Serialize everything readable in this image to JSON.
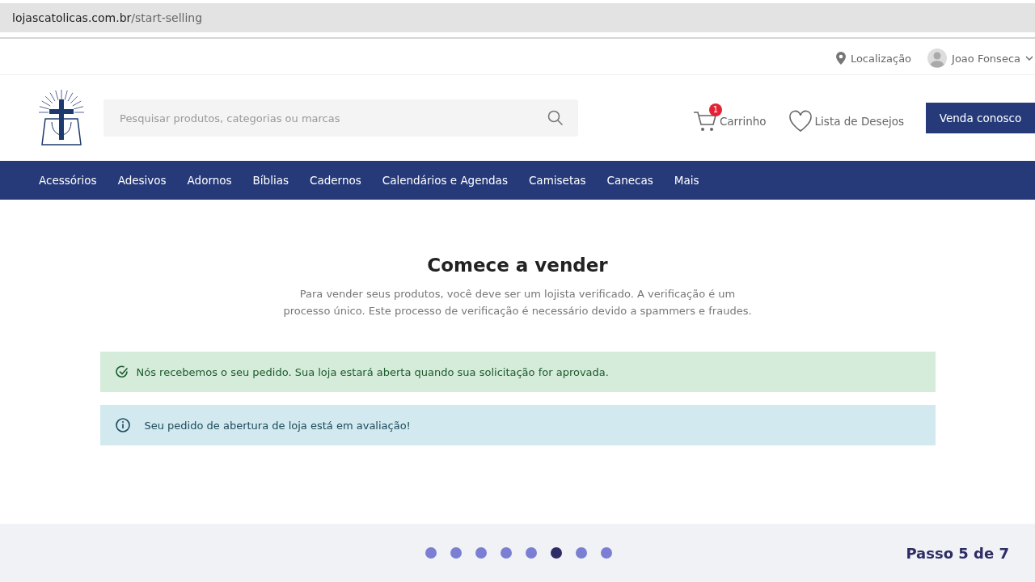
{
  "browser": {
    "url_host": "lojascatolicas.com.br",
    "url_path": "/start-selling"
  },
  "topbar": {
    "location": "Localização",
    "user": "Joao Fonseca"
  },
  "header": {
    "search": {
      "placeholder": "Pesquisar produtos, categorias ou marcas"
    },
    "cart": {
      "label": "Carrinho",
      "count": "1"
    },
    "wishlist": "Lista de Desejos",
    "sell_button": "Venda conosco"
  },
  "nav": [
    "Acessórios",
    "Adesivos",
    "Adornos",
    "Bíblias",
    "Cadernos",
    "Calendários e Agendas",
    "Camisetas",
    "Canecas",
    "Mais"
  ],
  "main": {
    "title": "Comece a vender",
    "description": "Para vender seus produtos, você deve ser um lojista verificado. A verificação é um processo único. Este processo de verificação é necessário devido a spammers e fraudes.",
    "alerts": [
      {
        "kind": "success",
        "text": "Nós recebemos o seu pedido. Sua loja estará aberta quando sua solicitação for aprovada."
      },
      {
        "kind": "info",
        "text": "Seu pedido de abertura de loja está em avaliação!"
      }
    ]
  },
  "footer": {
    "steps": [
      {
        "selected": false
      },
      {
        "selected": false
      },
      {
        "selected": false
      },
      {
        "selected": false
      },
      {
        "selected": false
      },
      {
        "selected": true
      },
      {
        "selected": false
      },
      {
        "selected": false
      }
    ],
    "step_label": "Passo 5 de 7"
  }
}
